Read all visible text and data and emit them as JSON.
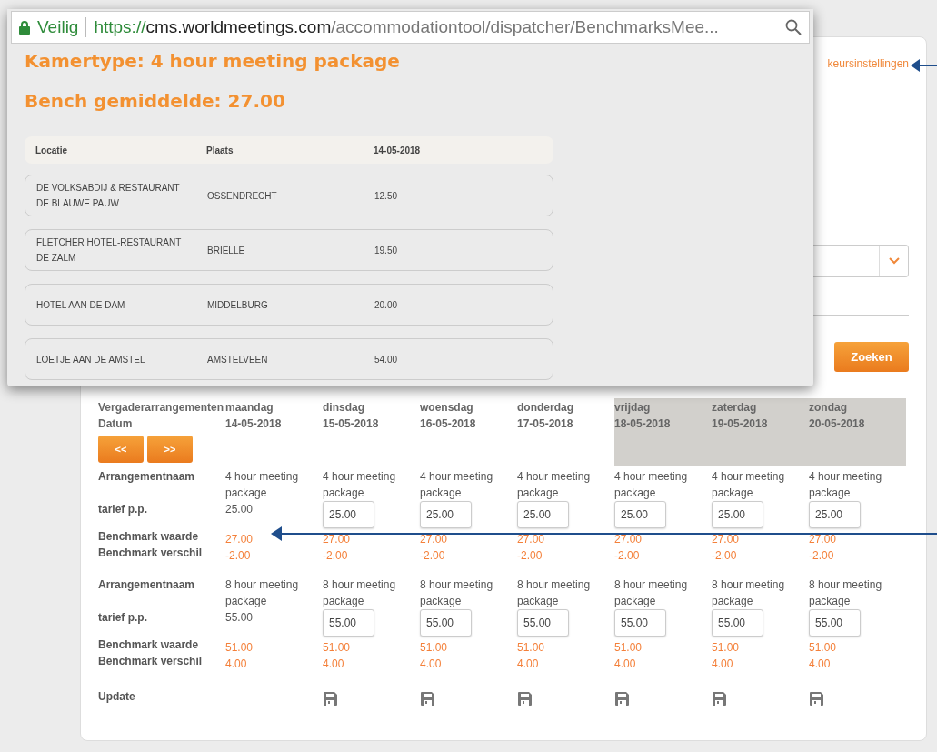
{
  "page": {
    "settings_link": "keursinstellingen",
    "search_button": "Zoeken",
    "grid": {
      "title": "Vergaderarrangementen",
      "date_label": "Datum",
      "prev_button": "<<",
      "next_button": ">>",
      "days": [
        {
          "day": "maandag",
          "date": "14-05-2018",
          "weekend": false,
          "save": false
        },
        {
          "day": "dinsdag",
          "date": "15-05-2018",
          "weekend": false,
          "save": true
        },
        {
          "day": "woensdag",
          "date": "16-05-2018",
          "weekend": false,
          "save": true
        },
        {
          "day": "donderdag",
          "date": "17-05-2018",
          "weekend": false,
          "save": true
        },
        {
          "day": "vrijdag",
          "date": "18-05-2018",
          "weekend": true,
          "save": true
        },
        {
          "day": "zaterdag",
          "date": "19-05-2018",
          "weekend": true,
          "save": true
        },
        {
          "day": "zondag",
          "date": "20-05-2018",
          "weekend": true,
          "save": true
        }
      ],
      "packages": [
        {
          "labels": [
            "Arrangementnaam",
            "tarief p.p.",
            "Benchmark waarde",
            "Benchmark verschil"
          ],
          "cells": [
            {
              "name": "4 hour meeting package",
              "tarief": "25.00",
              "editable": false,
              "benchmark": "27.00",
              "verschil": "-2.00"
            },
            {
              "name": "4 hour meeting package",
              "tarief": "25.00",
              "editable": true,
              "benchmark": "27.00",
              "verschil": "-2.00"
            },
            {
              "name": "4 hour meeting package",
              "tarief": "25.00",
              "editable": true,
              "benchmark": "27.00",
              "verschil": "-2.00"
            },
            {
              "name": "4 hour meeting package",
              "tarief": "25.00",
              "editable": true,
              "benchmark": "27.00",
              "verschil": "-2.00"
            },
            {
              "name": "4 hour meeting package",
              "tarief": "25.00",
              "editable": true,
              "benchmark": "27.00",
              "verschil": "-2.00"
            },
            {
              "name": "4 hour meeting package",
              "tarief": "25.00",
              "editable": true,
              "benchmark": "27.00",
              "verschil": "-2.00"
            },
            {
              "name": "4 hour meeting package",
              "tarief": "25.00",
              "editable": true,
              "benchmark": "27.00",
              "verschil": "-2.00"
            }
          ]
        },
        {
          "labels": [
            "Arrangementnaam",
            "tarief p.p.",
            "Benchmark waarde",
            "Benchmark verschil"
          ],
          "cells": [
            {
              "name": "8 hour meeting package",
              "tarief": "55.00",
              "editable": false,
              "benchmark": "51.00",
              "verschil": "4.00"
            },
            {
              "name": "8 hour meeting package",
              "tarief": "55.00",
              "editable": true,
              "benchmark": "51.00",
              "verschil": "4.00"
            },
            {
              "name": "8 hour meeting package",
              "tarief": "55.00",
              "editable": true,
              "benchmark": "51.00",
              "verschil": "4.00"
            },
            {
              "name": "8 hour meeting package",
              "tarief": "55.00",
              "editable": true,
              "benchmark": "51.00",
              "verschil": "4.00"
            },
            {
              "name": "8 hour meeting package",
              "tarief": "55.00",
              "editable": true,
              "benchmark": "51.00",
              "verschil": "4.00"
            },
            {
              "name": "8 hour meeting package",
              "tarief": "55.00",
              "editable": true,
              "benchmark": "51.00",
              "verschil": "4.00"
            },
            {
              "name": "8 hour meeting package",
              "tarief": "55.00",
              "editable": true,
              "benchmark": "51.00",
              "verschil": "4.00"
            }
          ]
        }
      ],
      "update_label": "Update"
    }
  },
  "popup": {
    "address_bar": {
      "secure_label": "Veilig",
      "url": {
        "scheme": "https://",
        "host": "cms.worldmeetings.com",
        "path": "/accommodationtool/dispatcher/BenchmarksMee..."
      }
    },
    "title": "Kamertype: 4 hour meeting package",
    "average": "Bench gemiddelde: 27.00",
    "table": {
      "columns": [
        "Locatie",
        "Plaats",
        "14-05-2018"
      ],
      "rows": [
        [
          "DE VOLKSABDIJ & RESTAURANT DE BLAUWE PAUW",
          "OSSENDRECHT",
          "12.50"
        ],
        [
          "FLETCHER HOTEL-RESTAURANT DE ZALM",
          "BRIELLE",
          "19.50"
        ],
        [
          "HOTEL AAN DE DAM",
          "MIDDELBURG",
          "20.00"
        ],
        [
          "LOETJE AAN DE AMSTEL",
          "AMSTELVEEN",
          "54.00"
        ]
      ]
    }
  }
}
